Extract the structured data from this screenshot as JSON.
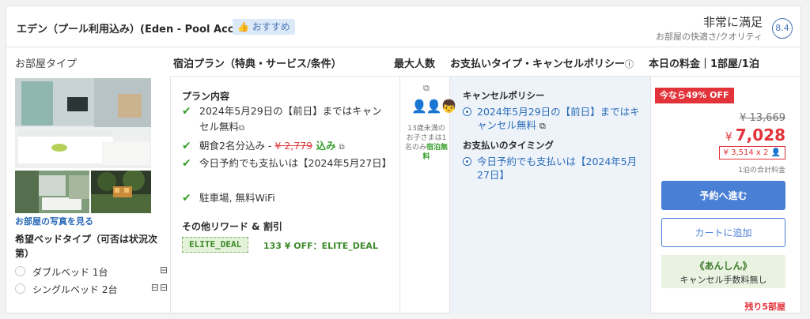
{
  "header": {
    "room_name": "エデン（プール利用込み）(Eden - Pool Access)",
    "recommend_badge": "おすすめ",
    "satisfaction": "非常に満足",
    "satisfaction_sub": "お部屋の快適さ/クオリティ",
    "score": "8.4"
  },
  "columns": {
    "room_type": "お部屋タイプ",
    "plan": "宿泊プラン（特典・サービス/条件）",
    "max_guests": "最大人数",
    "payment": "お支払いタイプ・キャンセルポリシー",
    "payment_info_icon": "ⓘ",
    "price": "本日の料金｜1部屋/1泊"
  },
  "room": {
    "photo_link": "お部屋の写真を見る",
    "bed_title": "希望ベッドタイプ（可否は状況次第）",
    "beds": [
      {
        "label": "ダブルベッド 1台",
        "icon": "bed-double-icon"
      },
      {
        "label": "シングルベッド 2台",
        "icon": "bed-twin-icon"
      }
    ]
  },
  "plan": {
    "title": "プラン内容",
    "features": [
      {
        "text": "2024年5月29日の【前日】まではキャンセル無料"
      },
      {
        "prefix": "朝食2名分込み - ",
        "strike": "¥ 2,779",
        "green": " 込み"
      },
      {
        "text": "今日予約でも支払いは【2024年5月27日】"
      },
      {
        "text": "駐車場, 無料WiFi"
      }
    ],
    "rewards_title": "その他リワード & 割引",
    "coupon_code": "ELITE_DEAL",
    "coupon_desc": "133 ¥ OFF：ELITE_DEAL"
  },
  "occupancy": {
    "note_a": "13歳未満のお子さまは1名のみ",
    "note_free": "宿泊無料"
  },
  "policy": {
    "cancel_title": "キャンセルポリシー",
    "cancel_text": "2024年5月29日の【前日】まではキャンセル無料",
    "timing_title": "お支払いのタイミング",
    "timing_text": "今日予約でも支払いは【2024年5月27日】"
  },
  "price": {
    "sale_badge": "今なら49% OFF",
    "old_price": "¥ 13,669",
    "yen": "¥",
    "new_price": "7,028",
    "per_person": "¥ 3,514 x 2",
    "total_note": "1泊の合計料金",
    "reserve_label": "予約へ進む",
    "cart_label": "カートに追加",
    "anshin_title": "《あんしん》",
    "anshin_sub": "キャンセル手数料無し",
    "rooms_left": "残り5部屋"
  },
  "colors": {
    "accent_blue": "#4a7fd6",
    "sale_red": "#e2323a",
    "check_green": "#38a02e"
  }
}
